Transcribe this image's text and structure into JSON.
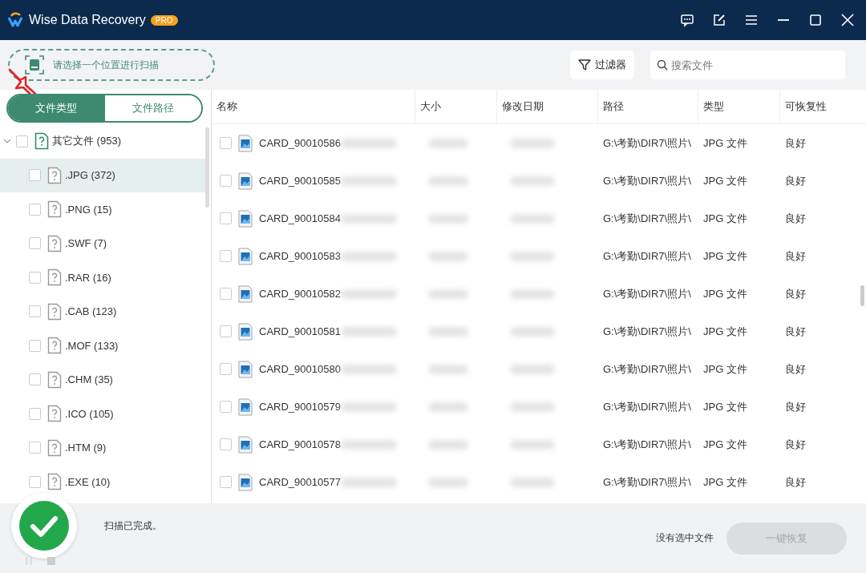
{
  "window": {
    "title": "Wise Data Recovery",
    "badge": "PRO"
  },
  "scan_location": {
    "placeholder": "请选择一个位置进行扫描"
  },
  "filter_button": "过滤器",
  "search": {
    "placeholder": "搜索文件"
  },
  "view_tabs": [
    {
      "label": "文件类型",
      "selected": true
    },
    {
      "label": "文件路径",
      "selected": false
    }
  ],
  "tree": [
    {
      "label": "其它文件 (953)",
      "expanded": true,
      "checked": false,
      "selected": false,
      "children": [
        {
          "label": ".JPG (372)",
          "checked": false,
          "selected": true
        },
        {
          "label": ".PNG (15)",
          "checked": false,
          "selected": false
        },
        {
          "label": ".SWF (7)",
          "checked": false,
          "selected": false
        },
        {
          "label": ".RAR (16)",
          "checked": false,
          "selected": false
        },
        {
          "label": ".CAB (123)",
          "checked": false,
          "selected": false
        },
        {
          "label": ".MOF (133)",
          "checked": false,
          "selected": false
        },
        {
          "label": ".CHM (35)",
          "checked": false,
          "selected": false
        },
        {
          "label": ".ICO (105)",
          "checked": false,
          "selected": false
        },
        {
          "label": ".HTM (9)",
          "checked": false,
          "selected": false
        },
        {
          "label": ".EXE (10)",
          "checked": false,
          "selected": false
        }
      ]
    }
  ],
  "table": {
    "columns": [
      "名称",
      "大小",
      "修改日期",
      "路径",
      "类型",
      "可恢复性"
    ],
    "rows": [
      {
        "name": "CARD_90010586",
        "path": "G:\\考勤\\DIR7\\照片\\",
        "type": "JPG 文件",
        "recoverability": "良好",
        "checked": false
      },
      {
        "name": "CARD_90010585",
        "path": "G:\\考勤\\DIR7\\照片\\",
        "type": "JPG 文件",
        "recoverability": "良好",
        "checked": false
      },
      {
        "name": "CARD_90010584",
        "path": "G:\\考勤\\DIR7\\照片\\",
        "type": "JPG 文件",
        "recoverability": "良好",
        "checked": false
      },
      {
        "name": "CARD_90010583",
        "path": "G:\\考勤\\DIR7\\照片\\",
        "type": "JPG 文件",
        "recoverability": "良好",
        "checked": false
      },
      {
        "name": "CARD_90010582",
        "path": "G:\\考勤\\DIR7\\照片\\",
        "type": "JPG 文件",
        "recoverability": "良好",
        "checked": false
      },
      {
        "name": "CARD_90010581",
        "path": "G:\\考勤\\DIR7\\照片\\",
        "type": "JPG 文件",
        "recoverability": "良好",
        "checked": false
      },
      {
        "name": "CARD_90010580",
        "path": "G:\\考勤\\DIR7\\照片\\",
        "type": "JPG 文件",
        "recoverability": "良好",
        "checked": false
      },
      {
        "name": "CARD_90010579",
        "path": "G:\\考勤\\DIR7\\照片\\",
        "type": "JPG 文件",
        "recoverability": "良好",
        "checked": false
      },
      {
        "name": "CARD_90010578",
        "path": "G:\\考勤\\DIR7\\照片\\",
        "type": "JPG 文件",
        "recoverability": "良好",
        "checked": false
      },
      {
        "name": "CARD_90010577",
        "path": "G:\\考勤\\DIR7\\照片\\",
        "type": "JPG 文件",
        "recoverability": "良好",
        "checked": false
      }
    ]
  },
  "status": {
    "message": "扫描已完成。",
    "selection": "没有选中文件",
    "recover_button": {
      "label": "一键恢复",
      "disabled": true
    }
  }
}
